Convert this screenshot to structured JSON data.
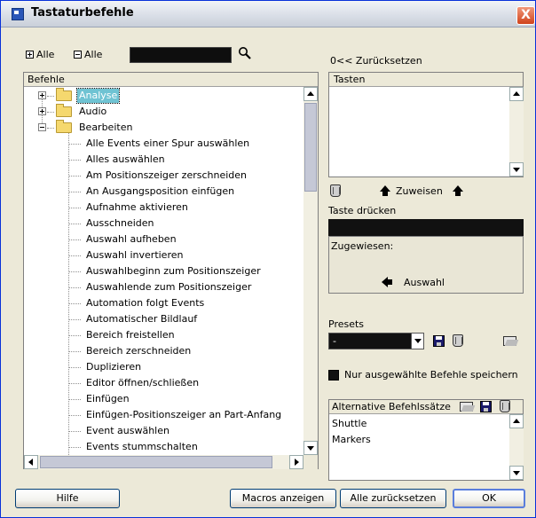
{
  "window": {
    "title": "Tastaturbefehle",
    "close_label": "X"
  },
  "toolbar": {
    "expand_all_label": "Alle",
    "collapse_all_label": "Alle",
    "search_value": ""
  },
  "commands": {
    "header": "Befehle",
    "groups": [
      {
        "label": "Analyse",
        "selected": true,
        "expanded": false
      },
      {
        "label": "Audio",
        "selected": false,
        "expanded": false
      },
      {
        "label": "Bearbeiten",
        "selected": false,
        "expanded": true
      }
    ],
    "items": [
      "Alle Events einer Spur auswählen",
      "Alles auswählen",
      "Am Positionszeiger zerschneiden",
      "An Ausgangsposition einfügen",
      "Aufnahme aktivieren",
      "Ausschneiden",
      "Auswahl aufheben",
      "Auswahl invertieren",
      "Auswahlbeginn zum Positionszeiger",
      "Auswahlende zum Positionszeiger",
      "Automation folgt Events",
      "Automatischer Bildlauf",
      "Bereich freistellen",
      "Bereich zerschneiden",
      "Duplizieren",
      "Editor öffnen/schließen",
      "Einfügen",
      "Einfügen-Positionszeiger an Part-Anfang",
      "Event auswählen",
      "Events stummschalten"
    ]
  },
  "keys": {
    "reset_label": "0<< Zurücksetzen",
    "header": "Tasten",
    "assign_label": "Zuweisen",
    "press_key_label": "Taste drücken",
    "assigned_label": "Zugewiesen:",
    "selection_label": "Auswahl"
  },
  "presets": {
    "label": "Presets",
    "selected": "-",
    "save_only_selected_label": "Nur ausgewählte Befehle speichern"
  },
  "alternatives": {
    "header": "Alternative Befehlssätze",
    "items": [
      "Shuttle",
      "Markers"
    ]
  },
  "footer": {
    "help_label": "Hilfe",
    "show_macros_label": "Macros anzeigen",
    "reset_all_label": "Alle zurücksetzen",
    "ok_label": "OK"
  },
  "colors": {
    "selection": "#6fc3d3",
    "folder": "#f5d86e",
    "dialog_bg": "#ece9d8",
    "close_button": "#d0431c"
  }
}
